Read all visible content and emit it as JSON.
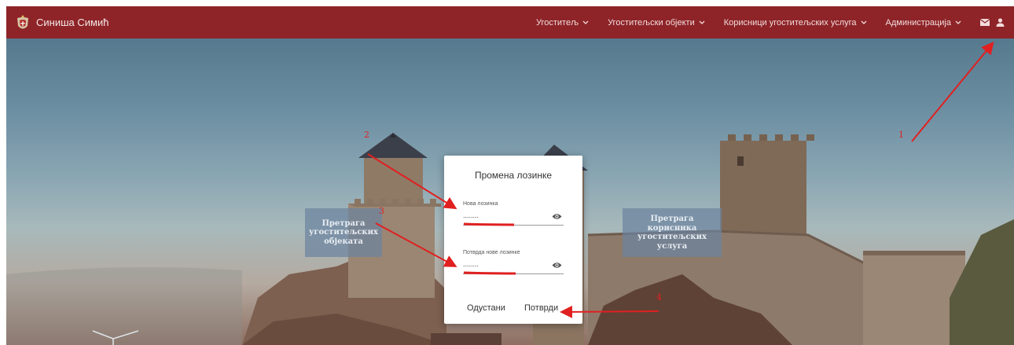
{
  "header": {
    "user_name": "Синиша Симић",
    "nav": [
      {
        "label": "Угоститељ"
      },
      {
        "label": "Угоститељски објекти"
      },
      {
        "label": "Корисници угоститељских услуга"
      },
      {
        "label": "Администрација"
      }
    ],
    "icons": [
      "envelope-icon",
      "user-icon"
    ]
  },
  "hero": {
    "tile_left": "Претрага угоститељских објеката",
    "tile_right": "Претрага корисника угоститељских услуга"
  },
  "dialog": {
    "title": "Промена лозинке",
    "new_password": {
      "label": "Нова лозинка",
      "value": "........"
    },
    "confirm_password": {
      "label": "Потврда нове лозинке",
      "value": "........"
    },
    "cancel_label": "Одустани",
    "confirm_label": "Потврди"
  },
  "annotations": [
    "1",
    "2",
    "3",
    "4"
  ],
  "colors": {
    "header": "#8e2428",
    "annotation": "#e02020"
  }
}
